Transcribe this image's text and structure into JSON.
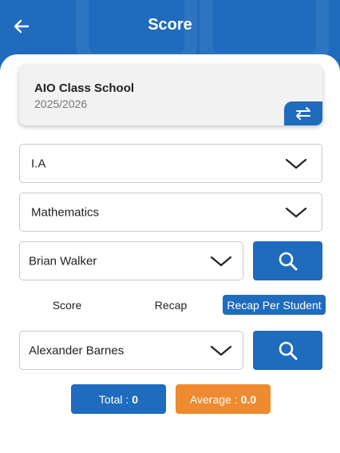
{
  "header": {
    "title": "Score"
  },
  "school": {
    "name": "AIO Class School",
    "year": "2025/2026"
  },
  "filters": {
    "class": "I.A",
    "subject": "Mathematics",
    "student": "Brian Walker"
  },
  "tabs": [
    {
      "label": "Score",
      "active": false
    },
    {
      "label": "Recap",
      "active": false
    },
    {
      "label": "Recap Per Student",
      "active": true
    }
  ],
  "recap_student": "Alexander Barnes",
  "stats": {
    "total_label": "Total :",
    "total_value": "0",
    "average_label": "Average :",
    "average_value": "0.0"
  },
  "colors": {
    "primary": "#1f6bbd",
    "accent": "#ee8a2f"
  }
}
